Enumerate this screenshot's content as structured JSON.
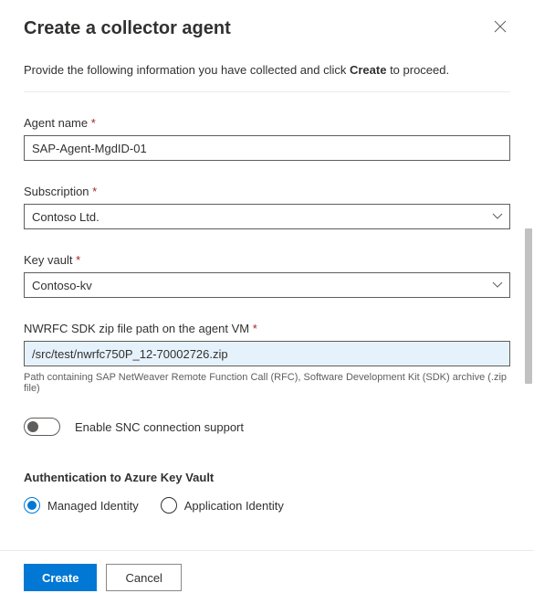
{
  "header": {
    "title": "Create a collector agent"
  },
  "intro": {
    "prefix": "Provide the following information you have collected and click ",
    "bold": "Create",
    "suffix": " to proceed."
  },
  "fields": {
    "agentName": {
      "label": "Agent name",
      "value": "SAP-Agent-MgdID-01"
    },
    "subscription": {
      "label": "Subscription",
      "value": "Contoso Ltd."
    },
    "keyVault": {
      "label": "Key vault",
      "value": "Contoso-kv"
    },
    "sdkPath": {
      "label": "NWRFC SDK zip file path on the agent VM",
      "value": "/src/test/nwrfc750P_12-70002726.zip",
      "hint": "Path containing SAP NetWeaver Remote Function Call (RFC), Software Development Kit (SDK) archive (.zip file)"
    }
  },
  "toggle": {
    "label": "Enable SNC connection support",
    "enabled": false
  },
  "auth": {
    "title": "Authentication to Azure Key Vault",
    "options": {
      "managed": "Managed Identity",
      "application": "Application Identity"
    },
    "selected": "managed"
  },
  "footer": {
    "create": "Create",
    "cancel": "Cancel"
  },
  "requiredMark": "*"
}
